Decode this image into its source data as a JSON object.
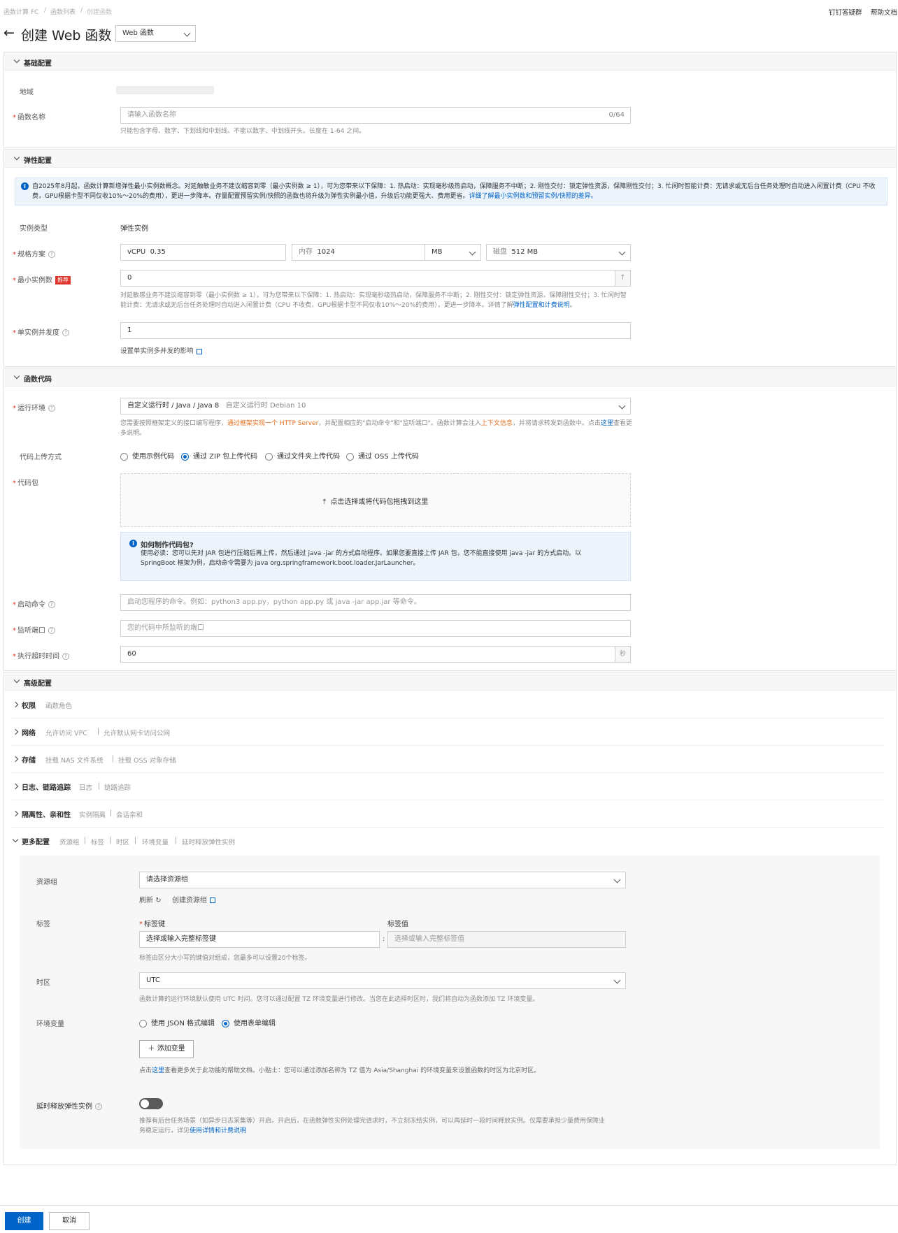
{
  "breadcrumb": [
    "函数计算 FC",
    "函数列表",
    "创建函数"
  ],
  "top_links": [
    "钉钉答疑群",
    "帮助文档"
  ],
  "page_title": "创建 Web 函数",
  "type_select": "Web 函数",
  "basic": {
    "title": "基础配置",
    "region_label": "地域",
    "name_label": "函数名称",
    "name_placeholder": "请输入函数名称",
    "name_counter": "0/64",
    "name_hint": "只能包含字母、数字、下划线和中划线。不能以数字、中划线开头。长度在 1-64 之间。"
  },
  "elastic": {
    "title": "弹性配置",
    "notice": "自2025年8月起，函数计算新增弹性最小实例数概念。对延触敏业务不建议缩容到零（最小实例数 ≥ 1），可为您带来以下保障：1. 热启动：实现毫秒级热启动，保障服务不中断；2. 刚性交付：锁定弹性资源，保障刚性交付；3. 忙闲时智能计费：无请求或无后台任务处理时自动进入闲置计费（CPU 不收费，GPU根据卡型不同仅收10%～20%的费用），更进一步降本。存量配置预留实例/快照的函数也将升级为弹性实例最小值，升级后功能更强大、费用更省。",
    "notice_link": "详细了解最小实例数和预留实例/快照的差异。",
    "instance_type_label": "实例类型",
    "instance_type_value": "弹性实例",
    "spec_label": "规格方案",
    "vcpu_prefix": "vCPU",
    "vcpu_value": "0.35",
    "mem_prefix": "内存",
    "mem_value": "1024",
    "mem_unit": "MB",
    "disk_prefix": "磁盘",
    "disk_value": "512 MB",
    "min_label": "最小实例数",
    "min_badge": "推荐",
    "min_value": "0",
    "min_hint": "对延敏感业务不建议缩容到零（最小实例数 ≥ 1），可为您带来以下保障：1. 热启动：实现毫秒级热启动，保障服务不中断；2. 刚性交付：锁定弹性资源，保障刚性交付；3. 忙闲时智能计费：无请求或无后台任务处理时自动进入闲置计费（CPU 不收费，GPU根据卡型不同仅收10%～20%的费用），更进一步降本。详情了解",
    "min_hint_link": "弹性配置和计费说明",
    "concurrency_label": "单实例并发度",
    "concurrency_value": "1",
    "concurrency_link": "设置单实例多并发的影响"
  },
  "code": {
    "title": "函数代码",
    "runtime_label": "运行环境",
    "runtime_value": "自定义运行时 / Java / Java 8",
    "runtime_extra": "自定义运行时  Debian 10",
    "runtime_hint_1": "您需要按照框架定义的接口编写程序，",
    "runtime_hint_link1": "通过框架实现一个 HTTP Server",
    "runtime_hint_2": "，并配置相应的\"启动命令\"和\"监听端口\"。函数计算会注入",
    "runtime_hint_link2": "上下文信息",
    "runtime_hint_3": "，并将请求转发到函数中。点击",
    "runtime_hint_link3": "这里",
    "runtime_hint_4": "查看更多说明。",
    "upload_label": "代码上传方式",
    "upload_options": [
      "使用示例代码",
      "通过 ZIP 包上传代码",
      "通过文件夹上传代码",
      "通过 OSS 上传代码"
    ],
    "package_label": "代码包",
    "drop_text": "点击选择或将代码包拖拽到这里",
    "tip_title": "如何制作代码包?",
    "tip_body_1": "使用必读：您可以先对 JAR 包进行压缩后再上传，然后通过 java -jar 的方式启动程序。如果您要直接上传 JAR 包，您不能直接使用 java -jar 的方式启动。以",
    "tip_body_2": "SpringBoot 框架为例，启动命令需要为 java org.springframework.boot.loader.JarLauncher。",
    "start_label": "启动命令",
    "start_placeholder": "启动您程序的命令。例如：python3 app.py，python app.py 或 java -jar app.jar 等命令。",
    "port_label": "监听端口",
    "port_placeholder": "您的代码中所监听的端口",
    "timeout_label": "执行超时时间",
    "timeout_value": "60",
    "timeout_unit": "秒"
  },
  "advanced": {
    "title": "高级配置",
    "rows": [
      {
        "name": "权限",
        "subs": [
          "函数角色"
        ]
      },
      {
        "name": "网络",
        "subs": [
          "允许访问 VPC",
          "允许默认网卡访问公网"
        ]
      },
      {
        "name": "存储",
        "subs": [
          "挂载 NAS 文件系统",
          "挂载 OSS 对象存储"
        ]
      },
      {
        "name": "日志、链路追踪",
        "subs": [
          "日志",
          "链路追踪"
        ]
      },
      {
        "name": "隔离性、亲和性",
        "subs": [
          "实例隔离",
          "会话亲和"
        ]
      },
      {
        "name": "更多配置",
        "subs": [
          "资源组",
          "标签",
          "时区",
          "环境变量",
          "延时释放弹性实例"
        ]
      }
    ],
    "resource_group_label": "资源组",
    "resource_group_placeholder": "请选择资源组",
    "refresh": "刷新",
    "create_rg": "创建资源组",
    "tag_label": "标签",
    "tag_key_label": "标签键",
    "tag_value_label": "标签值",
    "tag_key_placeholder": "选择或输入完整标签键",
    "tag_value_placeholder": "选择或输入完整标签值",
    "tag_hint": "标签由区分大小写的键值对组成，您最多可以设置20个标签。",
    "tz_label": "时区",
    "tz_value": "UTC",
    "tz_hint": "函数计算的运行环境默认使用 UTC 时间。您可以通过配置 TZ 环境变量进行修改。当您在此选择时区时，我们将自动为函数添加 TZ 环境变量。",
    "env_label": "环境变量",
    "env_options": [
      "使用 JSON 格式编辑",
      "使用表单编辑"
    ],
    "add_var": "添加变量",
    "env_hint_1": "点击",
    "env_hint_link": "这里",
    "env_hint_2": "查看更多关于此功能的帮助文档。小贴士：您可以通过添加名称为 TZ 值为 Asia/Shanghai 的环境变量来设置函数的时区为北京时区。",
    "delay_label": "延时释放弹性实例",
    "delay_hint_1": "推荐有后台任务场景（如异步日志采集等）开启。开启后，在函数弹性实例处理完请求时，不立刻冻结实例，可以再延时一段时间释放实例。仅需要承担少量费用保障业",
    "delay_hint_2": "务稳定运行，详见",
    "delay_hint_link": "使用详情和计费说明"
  },
  "footer": {
    "create": "创建",
    "cancel": "取消"
  }
}
